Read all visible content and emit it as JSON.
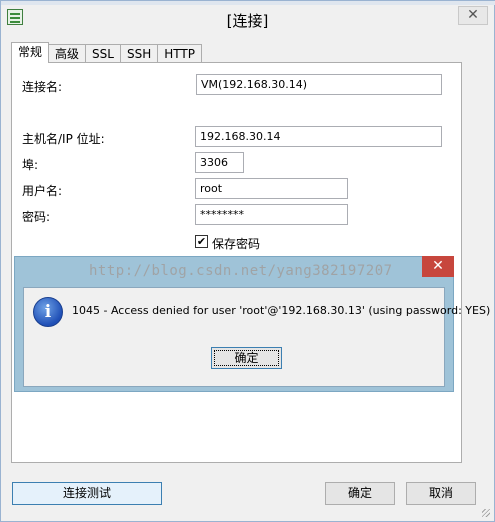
{
  "window": {
    "title": "[连接]",
    "close_glyph": "✕"
  },
  "tabs": [
    {
      "label": "常规",
      "active": true
    },
    {
      "label": "高级",
      "active": false
    },
    {
      "label": "SSL",
      "active": false
    },
    {
      "label": "SSH",
      "active": false
    },
    {
      "label": "HTTP",
      "active": false
    }
  ],
  "form": {
    "connection_name_label": "连接名:",
    "connection_name_value": "VM(192.168.30.14)",
    "host_label": "主机名/IP 位址:",
    "host_value": "192.168.30.14",
    "port_label": "埠:",
    "port_value": "3306",
    "user_label": "用户名:",
    "user_value": "root",
    "password_label": "密码:",
    "password_value": "********",
    "save_password_label": "保存密码",
    "save_password_checked": true,
    "check_glyph": "✔"
  },
  "error_dialog": {
    "watermark": "http://blog.csdn.net/yang382197207",
    "close_glyph": "✕",
    "icon_glyph": "i",
    "message": "1045 - Access denied for user 'root'@'192.168.30.13' (using password: YES)",
    "ok_label": "确定"
  },
  "footer": {
    "test_label": "连接测试",
    "ok_label": "确定",
    "cancel_label": "取消"
  },
  "icons": [
    "app-icon",
    "close-icon",
    "info-icon",
    "checkmark-icon",
    "resize-grip-icon"
  ]
}
